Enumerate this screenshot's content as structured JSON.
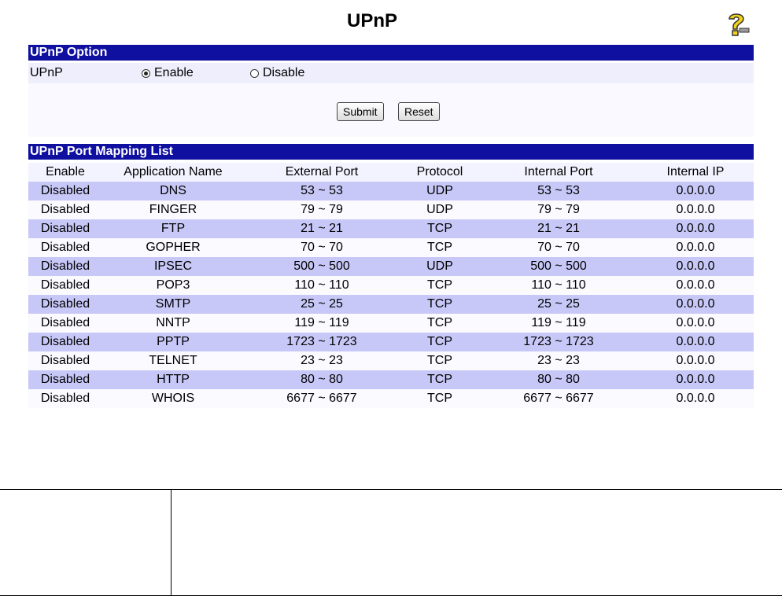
{
  "page": {
    "title": "UPnP"
  },
  "help": {
    "icon": "question-mark-help-icon"
  },
  "option_section": {
    "header": "UPnP Option",
    "label": "UPnP",
    "options": [
      {
        "label": "Enable",
        "checked": true
      },
      {
        "label": "Disable",
        "checked": false
      }
    ],
    "buttons": {
      "submit": "Submit",
      "reset": "Reset"
    }
  },
  "mapping_section": {
    "header": "UPnP Port Mapping List",
    "columns": [
      "Enable",
      "Application Name",
      "External Port",
      "Protocol",
      "Internal Port",
      "Internal IP"
    ],
    "rows": [
      [
        "Disabled",
        "DNS",
        "53 ~ 53",
        "UDP",
        "53 ~ 53",
        "0.0.0.0"
      ],
      [
        "Disabled",
        "FINGER",
        "79 ~ 79",
        "UDP",
        "79 ~ 79",
        "0.0.0.0"
      ],
      [
        "Disabled",
        "FTP",
        "21 ~ 21",
        "TCP",
        "21 ~ 21",
        "0.0.0.0"
      ],
      [
        "Disabled",
        "GOPHER",
        "70 ~ 70",
        "TCP",
        "70 ~ 70",
        "0.0.0.0"
      ],
      [
        "Disabled",
        "IPSEC",
        "500 ~ 500",
        "UDP",
        "500 ~ 500",
        "0.0.0.0"
      ],
      [
        "Disabled",
        "POP3",
        "110 ~ 110",
        "TCP",
        "110 ~ 110",
        "0.0.0.0"
      ],
      [
        "Disabled",
        "SMTP",
        "25 ~ 25",
        "TCP",
        "25 ~ 25",
        "0.0.0.0"
      ],
      [
        "Disabled",
        "NNTP",
        "119 ~ 119",
        "TCP",
        "119 ~ 119",
        "0.0.0.0"
      ],
      [
        "Disabled",
        "PPTP",
        "1723 ~ 1723",
        "TCP",
        "1723 ~ 1723",
        "0.0.0.0"
      ],
      [
        "Disabled",
        "TELNET",
        "23 ~ 23",
        "TCP",
        "23 ~ 23",
        "0.0.0.0"
      ],
      [
        "Disabled",
        "HTTP",
        "80 ~ 80",
        "TCP",
        "80 ~ 80",
        "0.0.0.0"
      ],
      [
        "Disabled",
        "WHOIS",
        "6677 ~ 6677",
        "TCP",
        "6677 ~ 6677",
        "0.0.0.0"
      ]
    ]
  },
  "colors": {
    "header_bar": "#0f0fa0",
    "row_stripe": "#c8c8f8",
    "panel_bg": "#eeeefc"
  }
}
